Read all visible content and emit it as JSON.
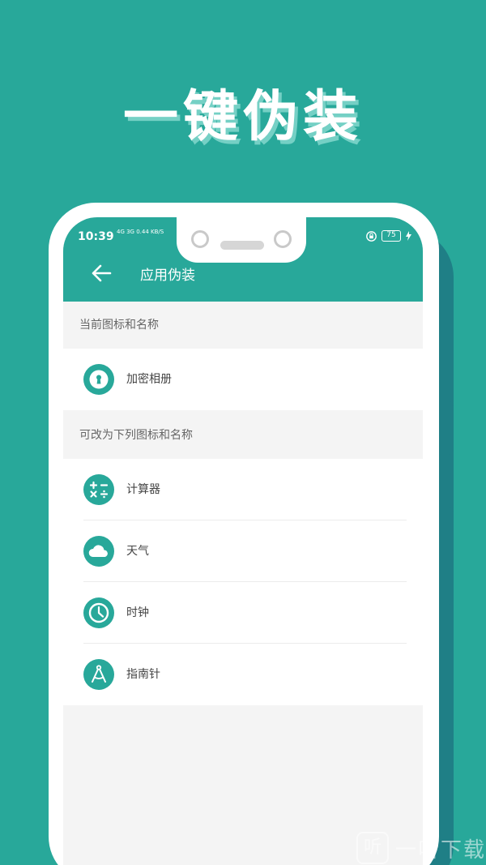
{
  "headline": "一键伪装",
  "status_bar": {
    "time": "10:39",
    "signal_info": "4G 3G 0.44 KB/S",
    "battery": "75"
  },
  "appbar": {
    "title": "应用伪装",
    "back_icon": "arrow-left-icon"
  },
  "current_section": {
    "header": "当前图标和名称",
    "item": {
      "label": "加密相册",
      "icon": "keyhole-icon"
    }
  },
  "options_section": {
    "header": "可改为下列图标和名称",
    "items": [
      {
        "label": "计算器",
        "icon": "calculator-icon"
      },
      {
        "label": "天气",
        "icon": "cloud-icon"
      },
      {
        "label": "时钟",
        "icon": "clock-icon"
      },
      {
        "label": "指南针",
        "icon": "compass-icon"
      }
    ]
  },
  "watermark": {
    "glyph": "听",
    "text": "一听下载"
  },
  "colors": {
    "accent": "#28a89a",
    "phone_shadow": "#1f7f86",
    "background": "#f4f4f4"
  }
}
